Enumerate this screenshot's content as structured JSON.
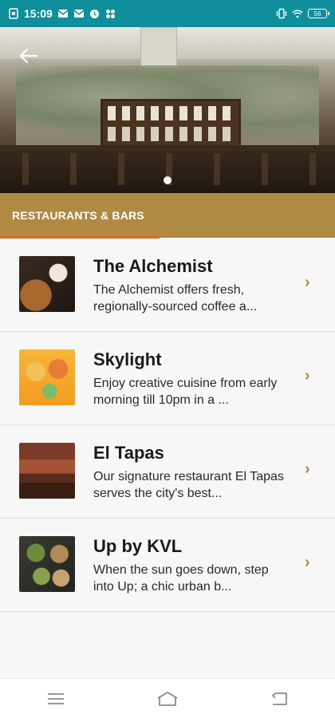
{
  "status_bar": {
    "time": "15:09",
    "battery": "56",
    "icons": [
      "sim-card-icon",
      "mail-icon",
      "mail-icon",
      "clock-icon",
      "grid-icon",
      "vibrate-icon",
      "wifi-icon",
      "battery-icon"
    ]
  },
  "hero": {
    "back_icon": "back-arrow-icon",
    "carousel_index": 1,
    "carousel_count": 1
  },
  "section": {
    "title": "RESTAURANTS & BARS",
    "accent_color": "#b08943",
    "underline_color": "#d86a1f"
  },
  "list": {
    "items": [
      {
        "title": "The Alchemist",
        "description": "The Alchemist offers fresh, regionally-sourced coffee a...",
        "chevron": "›"
      },
      {
        "title": "Skylight",
        "description": "Enjoy creative cuisine from early morning till 10pm in a ...",
        "chevron": "›"
      },
      {
        "title": "El Tapas",
        "description": "Our signature restaurant El Tapas serves the city's best...",
        "chevron": "›"
      },
      {
        "title": "Up by KVL",
        "description": "When the sun goes down, step into Up; a chic urban b...",
        "chevron": "›"
      }
    ]
  },
  "nav": {
    "icons": [
      "menu-icon",
      "home-icon",
      "back-icon"
    ]
  },
  "colors": {
    "status_bar": "#0f8e9b",
    "chevron": "#b08943",
    "background": "#f7f7f7"
  }
}
